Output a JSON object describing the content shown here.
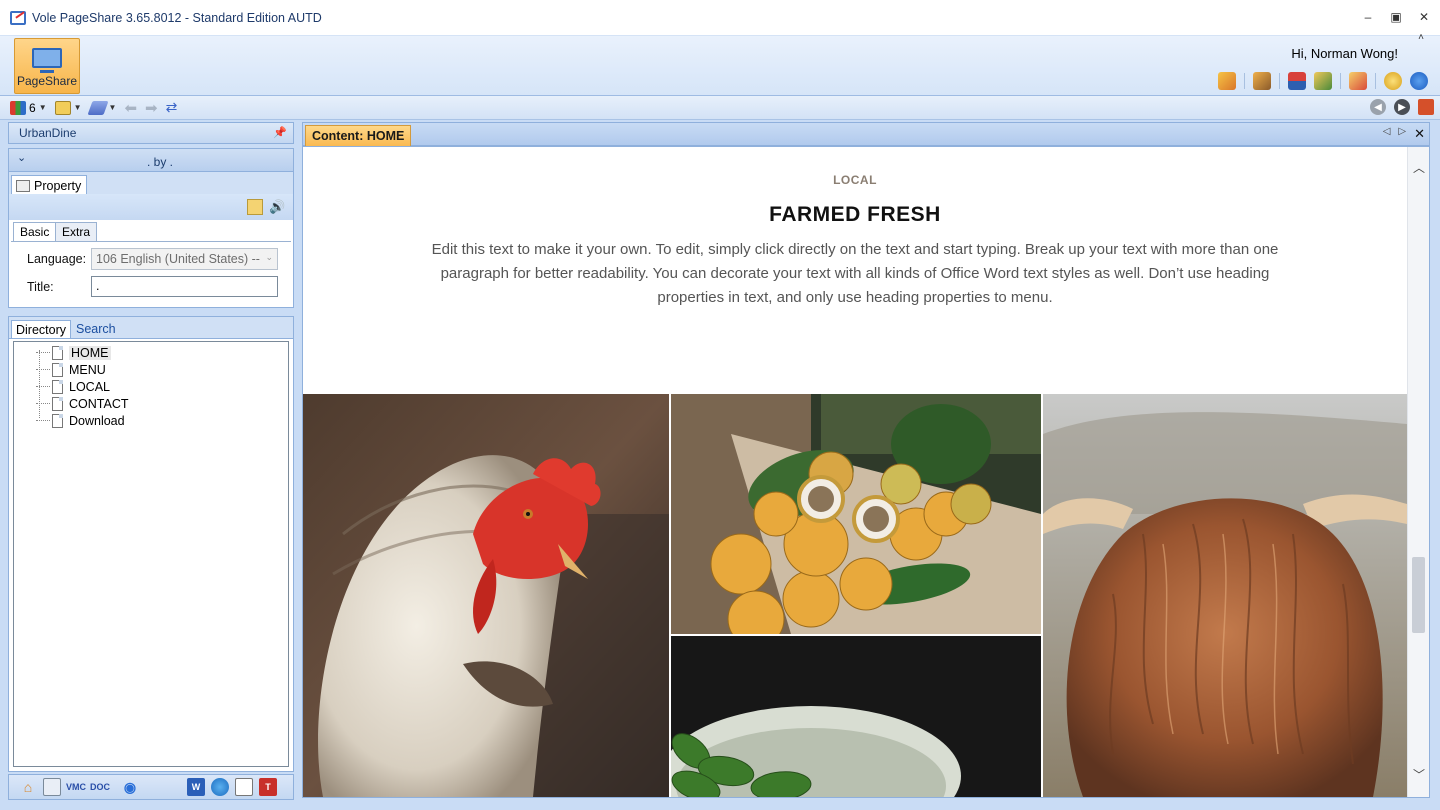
{
  "window": {
    "title": "Vole PageShare  3.65.8012 - Standard Edition AUTD",
    "minimize": "–",
    "maximize": "▣",
    "close": "✕"
  },
  "ribbon": {
    "main_button_label": "PageShare",
    "greeting": "Hi, Norman Wong!",
    "collapse_glyph": "˄",
    "icons": [
      "brush-icon",
      "tools-icon",
      "sign-icon",
      "calendar-icon",
      "run-icon",
      "stopwatch-icon",
      "info-icon"
    ]
  },
  "toolbar": {
    "count": "6",
    "icons": [
      "blocks-icon",
      "page-layout-icon",
      "stack-icon",
      "back-arrow-icon",
      "forward-arrow-icon",
      "refresh-icon"
    ],
    "right_icons": [
      "nav-back-circle-icon",
      "nav-forward-circle-icon",
      "powerpoint-icon"
    ]
  },
  "left_panel": {
    "header": "UrbanDine",
    "collapse_text": ". by .",
    "property_tab": "Property",
    "basic_tab": "Basic",
    "extra_tab": "Extra",
    "language_label": "Language:",
    "language_value": "106 English (United States) --",
    "title_label": "Title:",
    "title_value": ".",
    "directory_tab": "Directory",
    "search_tab": "Search",
    "tree": [
      {
        "label": "HOME",
        "selected": true
      },
      {
        "label": "MENU",
        "selected": false
      },
      {
        "label": "LOCAL",
        "selected": false
      },
      {
        "label": "CONTACT",
        "selected": false
      },
      {
        "label": "Download",
        "selected": false
      }
    ],
    "bottom_icons": [
      "home-icon",
      "web-page-icon",
      "vmc-icon",
      "doc-icon",
      "eye-icon",
      "word-icon",
      "globe-icon",
      "new-doc-icon",
      "text-icon"
    ]
  },
  "content": {
    "tab_label": "Content: HOME",
    "kicker": "LOCAL",
    "headline": "FARMED FRESH",
    "body": "Edit this text to make it your own. To edit, simply click directly on the text and start typing. Break up your text with more than one paragraph for better readability. You can decorate your text with all kinds of Office Word text styles as well. Don’t use heading properties in text, and only use heading properties to menu.",
    "images": [
      "chicken-photo",
      "passion-fruit-photo",
      "cucumber-bowl-photo",
      "highland-cow-photo"
    ]
  },
  "colors": {
    "accent_tab": "#f9b84f",
    "pane_border": "#8fb0dc",
    "kicker": "#8a7e72"
  }
}
